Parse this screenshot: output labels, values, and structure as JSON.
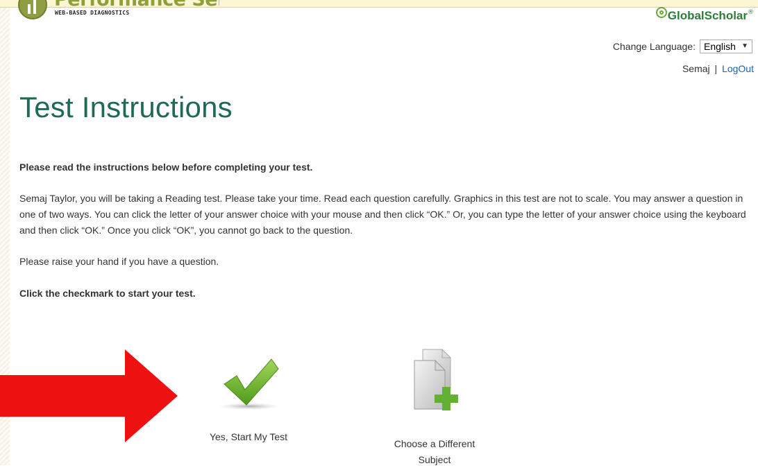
{
  "header": {
    "logo_name": "Performance Series",
    "logo_tm": "®",
    "logo_subtitle": "WEB-BASED DIAGNOSTICS",
    "brand": "GlobalScholar",
    "brand_tm": "®"
  },
  "language": {
    "label": "Change Language:",
    "selected": "English"
  },
  "user": {
    "name": "Semaj",
    "separator": "|",
    "logout": "LogOut"
  },
  "page": {
    "title": "Test Instructions",
    "intro": "Please read the instructions below before completing your test.",
    "body": "Semaj Taylor, you will be taking a Reading test. Please take your time. Read each question carefully. Graphics in this test are not to scale. You may answer a question in one of two ways. You can click the letter of your answer choice with your mouse and then click “OK.” Or, you can type the letter of your answer choice using the keyboard and then click “OK.” Once you click “OK”, you cannot go back to the question.",
    "question_note": "Please raise your hand if you have a question.",
    "start_prompt": "Click the checkmark to start your test."
  },
  "actions": {
    "start_label": "Yes, Start My Test",
    "change_label_line1": "Choose a Different",
    "change_label_line2": "Subject"
  },
  "colors": {
    "title": "#1f6a57",
    "link": "#1f5fbf",
    "arrow": "#ee1111",
    "check": "#72b52c",
    "brand": "#2d7d3b",
    "logo": "#8ea03a"
  },
  "icons": {
    "start": "checkmark-icon",
    "change_subject": "add-document-icon",
    "annotation": "red-arrow"
  }
}
